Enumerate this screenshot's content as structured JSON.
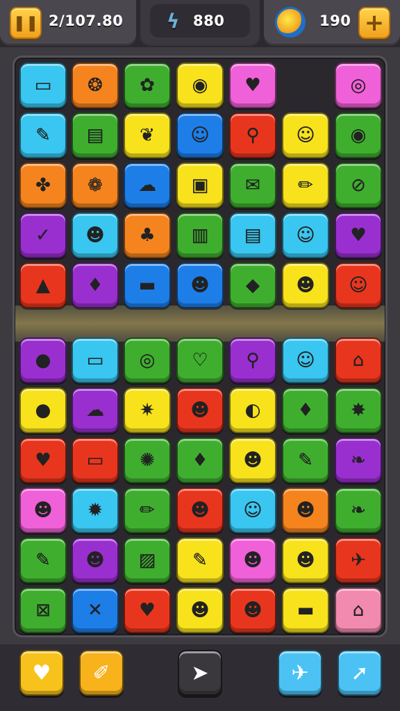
{
  "hud": {
    "coins_value": "2/107.80",
    "moves_value": "880",
    "gems_value": "190",
    "left_icon": "pause-icon",
    "mid_icon": "lightning-icon",
    "gem_icon": "gem-icon",
    "add_label": "+"
  },
  "colors": {
    "cyan": "#39c6f0",
    "orange": "#f5841e",
    "green": "#3fae2f",
    "yellow": "#f7e21c",
    "pink": "#f060d8",
    "blue": "#1e7ee8",
    "red": "#e8361e",
    "purple": "#9a2fd0",
    "rose": "#f28ab0"
  },
  "board": {
    "rows": [
      [
        {
          "c": "cyan",
          "g": "▭",
          "n": "bunny-icon"
        },
        {
          "c": "orange",
          "g": "❂",
          "n": "swirl-icon"
        },
        {
          "c": "green",
          "g": "✿",
          "n": "flower-icon"
        },
        {
          "c": "yellow",
          "g": "◉",
          "n": "target-icon"
        },
        {
          "c": "pink",
          "g": "♥",
          "n": "heart-bubble-icon"
        },
        {
          "c": "empty",
          "g": "",
          "n": "empty-cell"
        },
        {
          "c": "pink",
          "g": "◎",
          "n": "donut-icon"
        }
      ],
      [
        {
          "c": "cyan",
          "g": "✎",
          "n": "mic-icon"
        },
        {
          "c": "green",
          "g": "▤",
          "n": "calendar-icon"
        },
        {
          "c": "yellow",
          "g": "❦",
          "n": "leaf-icon"
        },
        {
          "c": "blue",
          "g": "☺",
          "n": "smiley-icon"
        },
        {
          "c": "red",
          "g": "⚲",
          "n": "pin-icon"
        },
        {
          "c": "yellow",
          "g": "☺",
          "n": "face-icon"
        },
        {
          "c": "green",
          "g": "◉",
          "n": "robot-icon"
        }
      ],
      [
        {
          "c": "orange",
          "g": "✤",
          "n": "maple-leaf-icon"
        },
        {
          "c": "orange",
          "g": "❁",
          "n": "sun-flower-icon"
        },
        {
          "c": "blue",
          "g": "☁",
          "n": "palette-icon"
        },
        {
          "c": "yellow",
          "g": "▣",
          "n": "bag-icon"
        },
        {
          "c": "green",
          "g": "✉",
          "n": "note-icon"
        },
        {
          "c": "yellow",
          "g": "✏",
          "n": "pencil-icon"
        },
        {
          "c": "green",
          "g": "⊘",
          "n": "ban-icon"
        }
      ],
      [
        {
          "c": "purple",
          "g": "✓",
          "n": "check-leaf-icon"
        },
        {
          "c": "cyan",
          "g": "☻",
          "n": "onion-face-icon"
        },
        {
          "c": "orange",
          "g": "♣",
          "n": "tree-icon"
        },
        {
          "c": "green",
          "g": "▥",
          "n": "bottles-icon"
        },
        {
          "c": "cyan",
          "g": "▤",
          "n": "notepad-icon"
        },
        {
          "c": "cyan",
          "g": "☺",
          "n": "blob-face-icon"
        },
        {
          "c": "purple",
          "g": "♥",
          "n": "heart-icon"
        }
      ],
      [
        {
          "c": "red",
          "g": "▲",
          "n": "car-icon"
        },
        {
          "c": "purple",
          "g": "♦",
          "n": "balloon-icon"
        },
        {
          "c": "blue",
          "g": "▬",
          "n": "flag-icon"
        },
        {
          "c": "blue",
          "g": "☻",
          "n": "pink-face-icon"
        },
        {
          "c": "green",
          "g": "◆",
          "n": "feather-icon"
        },
        {
          "c": "yellow",
          "g": "☻",
          "n": "bird-icon"
        },
        {
          "c": "red",
          "g": "☺",
          "n": "happy-icon"
        }
      ],
      [
        {
          "c": "purple",
          "g": "●",
          "n": "dark-face-icon"
        },
        {
          "c": "cyan",
          "g": "▭",
          "n": "radio-icon"
        },
        {
          "c": "green",
          "g": "◎",
          "n": "ring-icon"
        },
        {
          "c": "green",
          "g": "♡",
          "n": "heart-outline-icon"
        },
        {
          "c": "purple",
          "g": "⚲",
          "n": "magnifier-icon"
        },
        {
          "c": "cyan",
          "g": "☺",
          "n": "sky-face-icon"
        },
        {
          "c": "red",
          "g": "⌂",
          "n": "house-chart-icon"
        }
      ],
      [
        {
          "c": "yellow",
          "g": "●",
          "n": "gray-face-icon"
        },
        {
          "c": "purple",
          "g": "☁",
          "n": "cloud-icon"
        },
        {
          "c": "yellow",
          "g": "✷",
          "n": "gear-flower-icon"
        },
        {
          "c": "red",
          "g": "☻",
          "n": "brown-face-icon"
        },
        {
          "c": "yellow",
          "g": "◐",
          "n": "egg-icon"
        },
        {
          "c": "green",
          "g": "♦",
          "n": "apple-icon"
        },
        {
          "c": "green",
          "g": "✸",
          "n": "star-burst-icon"
        }
      ],
      [
        {
          "c": "red",
          "g": "♥",
          "n": "lollipop-heart-icon"
        },
        {
          "c": "red",
          "g": "▭",
          "n": "tape-icon"
        },
        {
          "c": "green",
          "g": "✺",
          "n": "sun-icon"
        },
        {
          "c": "green",
          "g": "♦",
          "n": "paint-brush-icon"
        },
        {
          "c": "yellow",
          "g": "☻",
          "n": "tomato-face-icon"
        },
        {
          "c": "green",
          "g": "✎",
          "n": "marker-icon"
        },
        {
          "c": "purple",
          "g": "❧",
          "n": "gold-leaf-icon"
        }
      ],
      [
        {
          "c": "pink",
          "g": "☻",
          "n": "green-blob-icon"
        },
        {
          "c": "cyan",
          "g": "✹",
          "n": "cog-icon"
        },
        {
          "c": "green",
          "g": "✏",
          "n": "crayon-icon"
        },
        {
          "c": "red",
          "g": "☻",
          "n": "grumpy-face-icon"
        },
        {
          "c": "cyan",
          "g": "☺",
          "n": "yellow-face-icon"
        },
        {
          "c": "orange",
          "g": "☻",
          "n": "frog-icon"
        },
        {
          "c": "green",
          "g": "❧",
          "n": "torch-icon"
        }
      ],
      [
        {
          "c": "green",
          "g": "✎",
          "n": "pen-icon"
        },
        {
          "c": "purple",
          "g": "☻",
          "n": "cookie-face-icon"
        },
        {
          "c": "green",
          "g": "▨",
          "n": "chart-icon"
        },
        {
          "c": "yellow",
          "g": "✎",
          "n": "icecream-icon"
        },
        {
          "c": "pink",
          "g": "☻",
          "n": "pink-blob-icon"
        },
        {
          "c": "yellow",
          "g": "☻",
          "n": "tan-face-icon"
        },
        {
          "c": "red",
          "g": "✈",
          "n": "jet-icon"
        }
      ],
      [
        {
          "c": "green",
          "g": "⊠",
          "n": "mute-icon"
        },
        {
          "c": "blue",
          "g": "✕",
          "n": "cross-icon"
        },
        {
          "c": "red",
          "g": "♥",
          "n": "pink-heart-icon"
        },
        {
          "c": "yellow",
          "g": "☻",
          "n": "green-monster-icon"
        },
        {
          "c": "red",
          "g": "☻",
          "n": "red-face-icon"
        },
        {
          "c": "yellow",
          "g": "▬",
          "n": "battery-icon"
        },
        {
          "c": "rose",
          "g": "⌂",
          "n": "house-bars-icon"
        }
      ]
    ]
  },
  "boosters": [
    {
      "name": "heart-booster-button",
      "icon": "♥",
      "color": "#f7c21c"
    },
    {
      "name": "shuffle-booster-button",
      "icon": "✐",
      "color": "#f7b21c"
    },
    {
      "name": "hint-button",
      "icon": "➤",
      "color": "#3a383d"
    },
    {
      "name": "rocket-booster-button",
      "icon": "✈",
      "color": "#4cc2f4"
    },
    {
      "name": "pointer-booster-button",
      "icon": "➚",
      "color": "#4cc2f4"
    }
  ]
}
